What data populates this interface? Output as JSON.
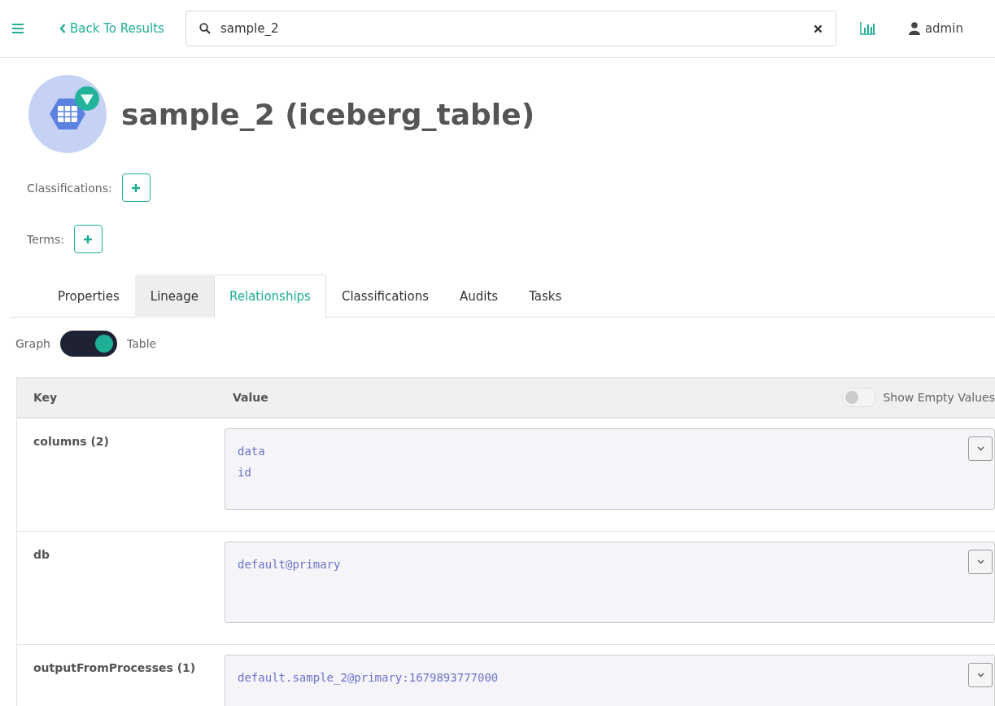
{
  "topbar": {
    "back_link": "Back To Results",
    "search": {
      "value": "sample_2"
    },
    "user": "admin"
  },
  "entity": {
    "title": "sample_2 (iceberg_table)"
  },
  "tag_rows": [
    {
      "label": "Classifications:"
    },
    {
      "label": "Terms:"
    }
  ],
  "tabs": [
    {
      "label": "Properties",
      "selected": false,
      "hovered": false
    },
    {
      "label": "Lineage",
      "selected": false,
      "hovered": true
    },
    {
      "label": "Relationships",
      "selected": true,
      "hovered": false
    },
    {
      "label": "Classifications",
      "selected": false,
      "hovered": false
    },
    {
      "label": "Audits",
      "selected": false,
      "hovered": false
    },
    {
      "label": "Tasks",
      "selected": false,
      "hovered": false
    }
  ],
  "view_toggle": {
    "left": "Graph",
    "right": "Table",
    "on": true
  },
  "table": {
    "columns": [
      "Key",
      "Value"
    ],
    "show_empty": {
      "label": "Show Empty Values",
      "on": false
    },
    "rows": [
      {
        "key": "columns (2)",
        "values": [
          "data",
          "id"
        ]
      },
      {
        "key": "db",
        "values": [
          "default@primary"
        ]
      },
      {
        "key": "outputFromProcesses (1)",
        "values": [
          "default.sample_2@primary:1679893777000"
        ]
      }
    ]
  }
}
